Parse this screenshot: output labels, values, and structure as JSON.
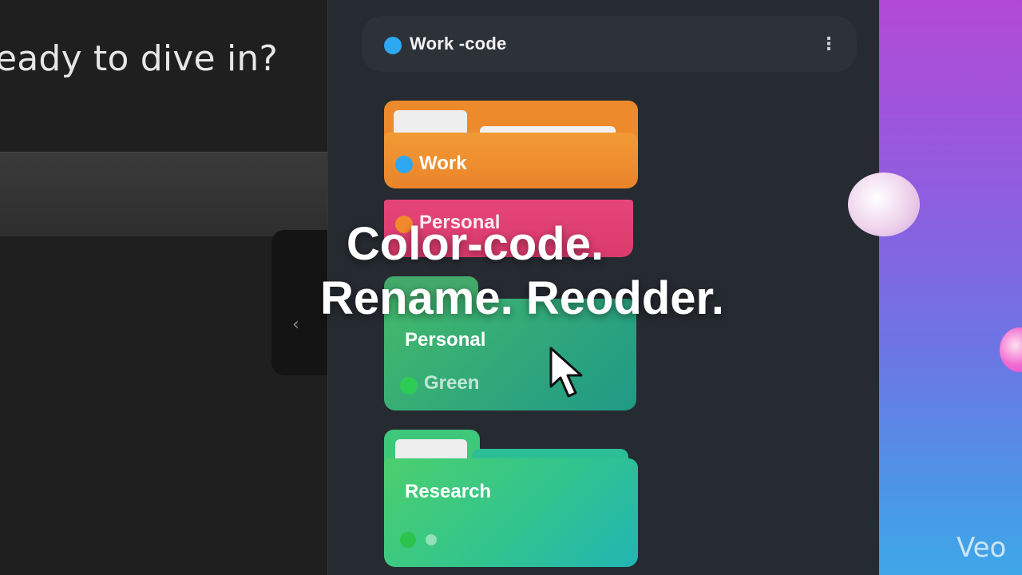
{
  "left": {
    "greeting": "eady to dive in?",
    "collapse_chevron": "‹"
  },
  "group": {
    "name": "Work -code",
    "dot_color": "#2ea8f2",
    "menu_icon": "⋮"
  },
  "folders": [
    {
      "label": "Work",
      "color": "#ec8a2c",
      "dot_color": "#2ea8f2"
    },
    {
      "label": "Personal",
      "color": "#e5457a",
      "dot_color": "#f08a2c"
    },
    {
      "label": "Personal",
      "sublabel": "Green",
      "color": "#43b96b",
      "dot_color": "#2ecc55"
    },
    {
      "label": "Research",
      "color": "#31c48e"
    }
  ],
  "headline": {
    "line1": "Color-code.",
    "line2": "Rename. Reodder."
  },
  "watermark": "Veo"
}
